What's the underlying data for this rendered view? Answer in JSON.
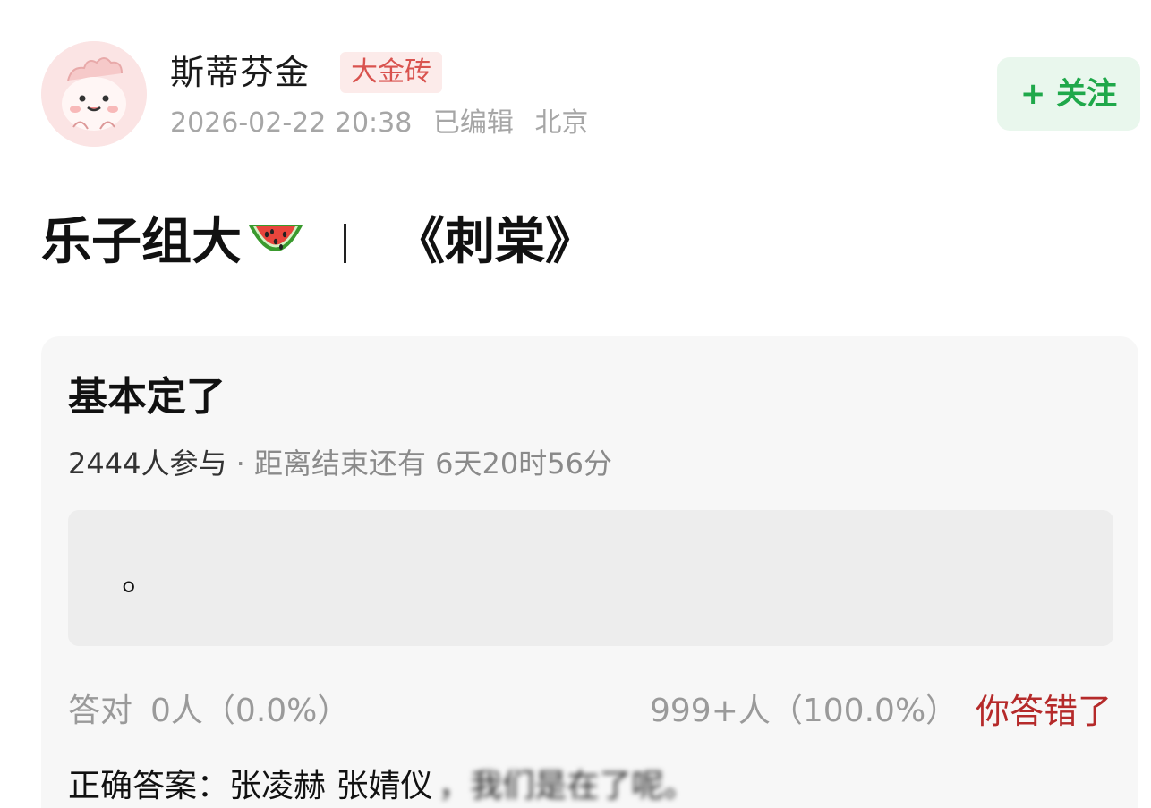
{
  "author": {
    "name": "斯蒂芬金",
    "badge": "大金砖",
    "date": "2026-02-22 20:38",
    "edited": "已编辑",
    "location": "北京"
  },
  "follow_button": {
    "label": "+ 关注"
  },
  "post": {
    "title_part1": "乐子组大",
    "title_part2": "《刺棠》"
  },
  "poll": {
    "title": "基本定了",
    "participants": "2444人参与",
    "separator": "·",
    "remaining": "距离结束还有 6天20时56分",
    "option_text": "。",
    "correct_label": "答对",
    "correct_stats": "0人（0.0%）",
    "wrong_stats": "999+人（100.0%）",
    "result": "你答错了",
    "answer_label": "正确答案：",
    "answer_value": "张凌赫 张婧仪",
    "answer_blurred": "，我们是在了呢。"
  },
  "colors": {
    "follow_bg": "#e9f7ed",
    "follow_text": "#1fa84a",
    "badge_text": "#d9534f",
    "wrong_text": "#b52a2a"
  }
}
